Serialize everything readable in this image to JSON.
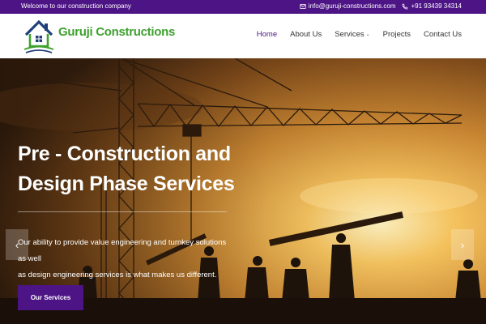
{
  "topbar": {
    "welcome": "Welcome to our construction company",
    "email": "info@guruji-constructions.com",
    "phone": "+91 93439 34314"
  },
  "header": {
    "brand": "Guruji Constructions",
    "nav": [
      {
        "label": "Home",
        "active": true
      },
      {
        "label": "About Us"
      },
      {
        "label": "Services",
        "has_dropdown": true
      },
      {
        "label": "Projects"
      },
      {
        "label": "Contact Us"
      }
    ]
  },
  "hero": {
    "title_line1": "Pre - Construction and",
    "title_line2": "Design Phase Services",
    "desc_line1": "Our ability to provide value engineering and turnkey solutions as well",
    "desc_line2": "as design engineering services is what makes us different.",
    "cta_label": "Our Services",
    "prev_icon": "‹",
    "next_icon": "›"
  },
  "colors": {
    "primary": "#4d1486",
    "brand_green": "#3ea12e"
  },
  "icons": {
    "email": "envelope-icon",
    "phone": "phone-icon",
    "prev": "chevron-left-icon",
    "next": "chevron-right-icon"
  }
}
